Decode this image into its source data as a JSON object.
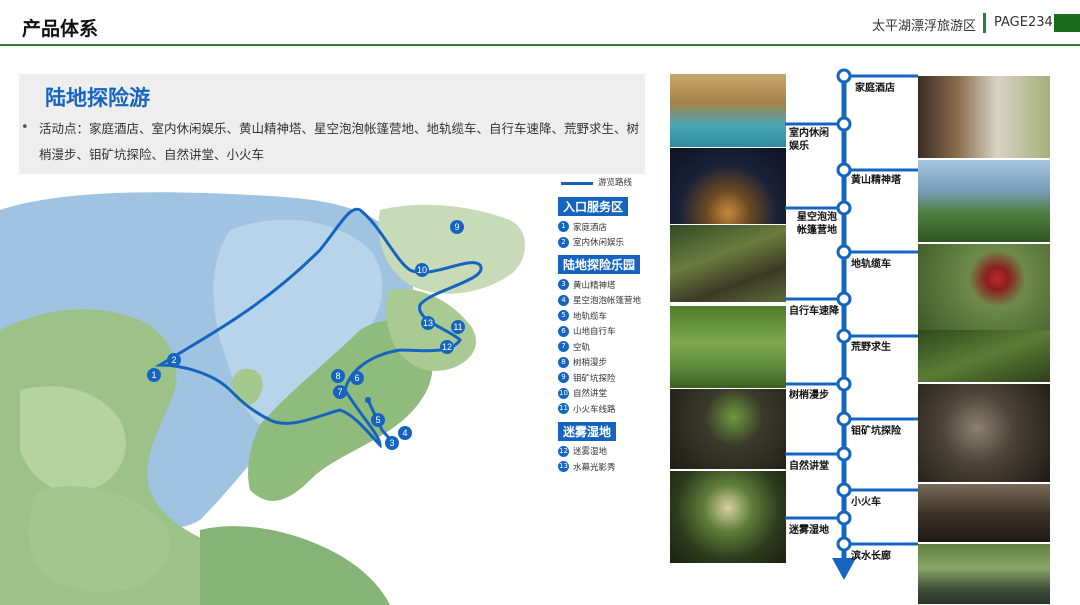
{
  "header": {
    "title": "产品体系",
    "doc_name": "太平湖漂浮旅游区",
    "page": "PAGE234"
  },
  "intro": {
    "title": "陆地探险游",
    "bullet": "•",
    "text": "活动点：家庭酒店、室内休闲娱乐、黄山精神塔、星空泡泡帐篷营地、地轨缆车、自行车速降、荒野求生、树梢漫步、钼矿坑探险、自然讲堂、小火车"
  },
  "map": {
    "markers": [
      "1",
      "2",
      "3",
      "4",
      "5",
      "6",
      "7",
      "8",
      "9",
      "10",
      "11",
      "12",
      "13"
    ]
  },
  "legend": {
    "route_label": "游览路线",
    "sections": [
      {
        "title": "入口服务区",
        "items": [
          {
            "num": "1",
            "label": "家庭酒店"
          },
          {
            "num": "2",
            "label": "室内休闲娱乐"
          }
        ]
      },
      {
        "title": "陆地探险乐园",
        "items": [
          {
            "num": "3",
            "label": "黄山精神塔"
          },
          {
            "num": "4",
            "label": "星空泡泡帐篷营地"
          },
          {
            "num": "5",
            "label": "地轨缆车"
          },
          {
            "num": "6",
            "label": "山地自行车"
          },
          {
            "num": "7",
            "label": "空轨"
          },
          {
            "num": "8",
            "label": "树梢漫步"
          },
          {
            "num": "9",
            "label": "钼矿坑探险"
          },
          {
            "num": "10",
            "label": "自然讲堂"
          },
          {
            "num": "11",
            "label": "小火车线路"
          }
        ]
      },
      {
        "title": "迷雾湿地",
        "items": [
          {
            "num": "12",
            "label": "迷雾湿地"
          },
          {
            "num": "13",
            "label": "水幕光影秀"
          }
        ]
      }
    ]
  },
  "timeline": {
    "color": "#1565c0",
    "stops": [
      "家庭酒店",
      "室内休闲娱乐",
      "黄山精神塔",
      "星空泡泡帐篷营地",
      "地轨缆车",
      "自行车速降",
      "荒野求生",
      "树梢漫步",
      "钼矿坑探险",
      "自然讲堂",
      "小火车",
      "迷雾湿地",
      "滨水长廊"
    ]
  }
}
